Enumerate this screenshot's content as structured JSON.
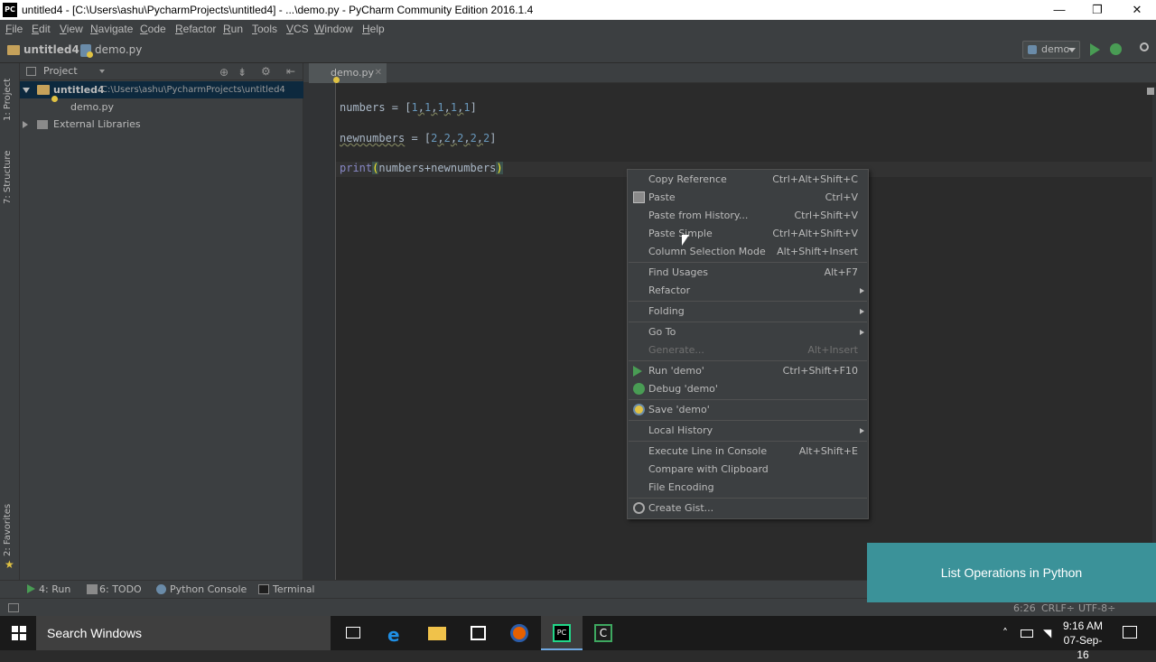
{
  "window": {
    "app_icon_text": "PC",
    "title": "untitled4 - [C:\\Users\\ashu\\PycharmProjects\\untitled4] - ...\\demo.py - PyCharm Community Edition 2016.1.4",
    "minimize": "—",
    "restore": "❐",
    "close": "✕"
  },
  "menu": [
    "File",
    "Edit",
    "View",
    "Navigate",
    "Code",
    "Refactor",
    "Run",
    "Tools",
    "VCS",
    "Window",
    "Help"
  ],
  "breadcrumb": {
    "project": "untitled4",
    "file": "demo.py"
  },
  "run_config": {
    "name": "demo"
  },
  "left_tabs": {
    "project": "1: Project",
    "structure": "7: Structure",
    "favorites": "2: Favorites"
  },
  "project_panel": {
    "header": "Project",
    "root_name": "untitled4",
    "root_path": "C:\\Users\\ashu\\PycharmProjects\\untitled4",
    "file": "demo.py",
    "external": "External Libraries"
  },
  "editor": {
    "tab": "demo.py",
    "line1": {
      "name": "numbers",
      "eq": " = [",
      "vals": [
        "1",
        "1",
        "1",
        "1",
        "1"
      ],
      "end": "]"
    },
    "line2": {
      "name": "newnumbers",
      "eq": " = [",
      "vals": [
        "2",
        "2",
        "2",
        "2",
        "2"
      ],
      "end": "]"
    },
    "line3": {
      "fn": "print",
      "open": "(",
      "args": "numbers+newnumbers",
      "close": ")"
    }
  },
  "context_menu": {
    "items": [
      {
        "label": "Copy Reference",
        "shortcut": "Ctrl+Alt+Shift+C"
      },
      {
        "label": "Paste",
        "shortcut": "Ctrl+V"
      },
      {
        "label": "Paste from History...",
        "shortcut": "Ctrl+Shift+V"
      },
      {
        "label": "Paste Simple",
        "shortcut": "Ctrl+Alt+Shift+V"
      },
      {
        "label": "Column Selection Mode",
        "shortcut": "Alt+Shift+Insert"
      },
      {
        "label": "Find Usages",
        "shortcut": "Alt+F7"
      },
      {
        "label": "Refactor",
        "shortcut": ""
      },
      {
        "label": "Folding",
        "shortcut": ""
      },
      {
        "label": "Go To",
        "shortcut": ""
      },
      {
        "label": "Generate...",
        "shortcut": "Alt+Insert"
      },
      {
        "label": "Run 'demo'",
        "shortcut": "Ctrl+Shift+F10"
      },
      {
        "label": "Debug 'demo'",
        "shortcut": ""
      },
      {
        "label": "Save 'demo'",
        "shortcut": ""
      },
      {
        "label": "Local History",
        "shortcut": ""
      },
      {
        "label": "Execute Line in Console",
        "shortcut": "Alt+Shift+E"
      },
      {
        "label": "Compare with Clipboard",
        "shortcut": ""
      },
      {
        "label": "File Encoding",
        "shortcut": ""
      },
      {
        "label": "Create Gist...",
        "shortcut": ""
      }
    ]
  },
  "bottom_tabs": {
    "run": "4: Run",
    "todo": "6: TODO",
    "console": "Python Console",
    "terminal": "Terminal"
  },
  "status": {
    "position": "6:26",
    "line_sep": "CRLF÷",
    "encoding": "UTF-8÷"
  },
  "overlay": {
    "text": "List Operations in Python"
  },
  "taskbar": {
    "search": "Search Windows",
    "time": "9:16 AM",
    "date": "07-Sep-16"
  },
  "colors": {
    "accent": "#3b9299",
    "selection": "#0d293e",
    "editor_bg": "#2b2b2b",
    "panel_bg": "#3c3f41"
  }
}
